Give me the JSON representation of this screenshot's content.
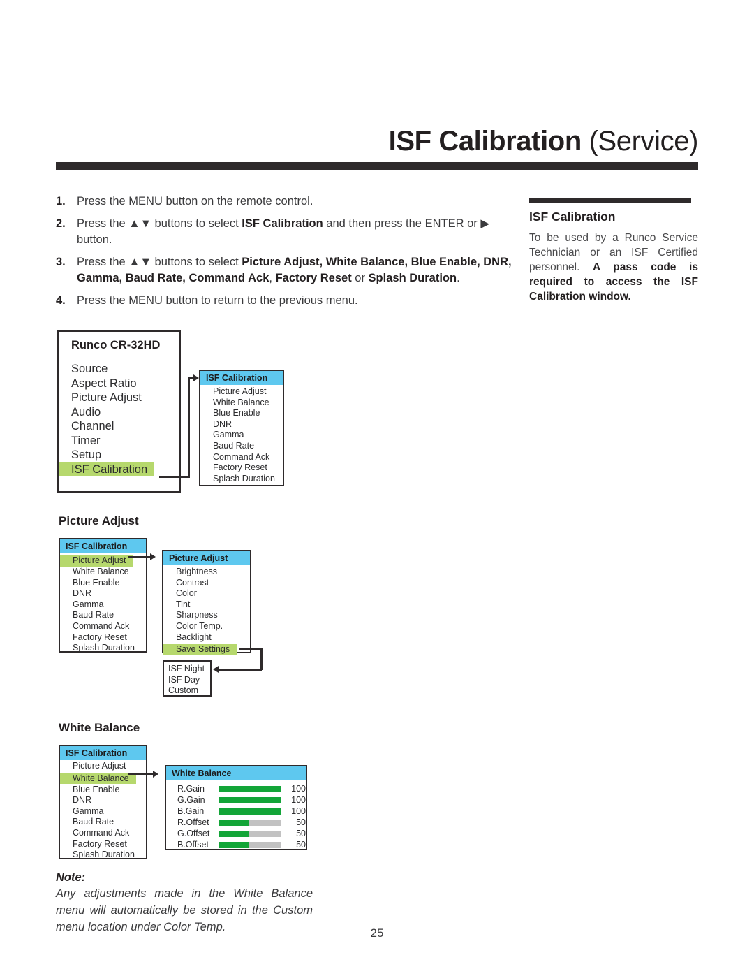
{
  "header": {
    "title_bold": "ISF Calibration",
    "title_regular": "(Service)"
  },
  "steps": [
    {
      "num": "1.",
      "html": "Press the MENU button on the remote control."
    },
    {
      "num": "2.",
      "html": "Press the ▲▼ buttons to select <b>ISF Calibration</b> and then press the ENTER or ▶ button."
    },
    {
      "num": "3.",
      "html": "Press the ▲▼ buttons to select <b>Picture Adjust, White Balance, Blue Enable, DNR, Gamma, Baud Rate, Command Ack</b>, <b>Factory Reset</b> or <b>Splash Duration</b>."
    },
    {
      "num": "4.",
      "html": "Press the MENU button to return to the previous menu."
    }
  ],
  "side_note": {
    "title": "ISF Calibration",
    "body_html": "To be used by a Runco Service Technician or an ISF Certified personnel. <b>A pass code is required to access the ISF Calibration window.</b>"
  },
  "diagram1": {
    "main_menu": {
      "title": "Runco CR-32HD",
      "items": [
        "Source",
        "Aspect Ratio",
        "Picture Adjust",
        "Audio",
        "Channel",
        "Timer",
        "Setup",
        "ISF Calibration"
      ],
      "highlighted": "ISF Calibration"
    },
    "submenu": {
      "header": "ISF Calibration",
      "items": [
        "Picture Adjust",
        "White Balance",
        "Blue Enable",
        "DNR",
        "Gamma",
        "Baud Rate",
        "Command Ack",
        "Factory Reset",
        "Splash Duration"
      ]
    }
  },
  "section_picture_adjust": {
    "heading": "Picture Adjust",
    "menu": {
      "header": "ISF Calibration",
      "items": [
        "Picture Adjust",
        "White Balance",
        "Blue Enable",
        "DNR",
        "Gamma",
        "Baud Rate",
        "Command Ack",
        "Factory Reset",
        "Splash Duration"
      ],
      "highlighted": "Picture Adjust"
    },
    "submenu": {
      "header": "Picture Adjust",
      "items": [
        "Brightness",
        "Contrast",
        "Color",
        "Tint",
        "Sharpness",
        "Color Temp.",
        "Backlight",
        "Save Settings"
      ],
      "highlighted": "Save Settings"
    },
    "popup": {
      "items": [
        "ISF Night",
        "ISF Day",
        "Custom"
      ]
    }
  },
  "section_white_balance": {
    "heading": "White Balance",
    "menu": {
      "header": "ISF Calibration",
      "items": [
        "Picture Adjust",
        "White Balance",
        "Blue Enable",
        "DNR",
        "Gamma",
        "Baud Rate",
        "Command Ack",
        "Factory Reset",
        "Splash Duration"
      ],
      "highlighted": "White Balance"
    },
    "panel": {
      "header": "White Balance",
      "rows": [
        {
          "label": "R.Gain",
          "value": "100",
          "percent": 100
        },
        {
          "label": "G.Gain",
          "value": "100",
          "percent": 100
        },
        {
          "label": "B.Gain",
          "value": "100",
          "percent": 100
        },
        {
          "label": "R.Offset",
          "value": "50",
          "percent": 48
        },
        {
          "label": "G.Offset",
          "value": "50",
          "percent": 48
        },
        {
          "label": "B.Offset",
          "value": "50",
          "percent": 48
        }
      ]
    }
  },
  "note": {
    "label": "Note:",
    "body": "Any adjustments made in the White Balance menu will automatically be stored in the Custom menu location under Color Temp."
  },
  "footer": {
    "page_number": "25"
  },
  "colors": {
    "highlight_green": "#b6d86d",
    "header_blue": "#5ec8ef",
    "bar_green": "#13a538",
    "bar_track": "#c2c2c2",
    "rule_dark": "#2e2a2b"
  }
}
